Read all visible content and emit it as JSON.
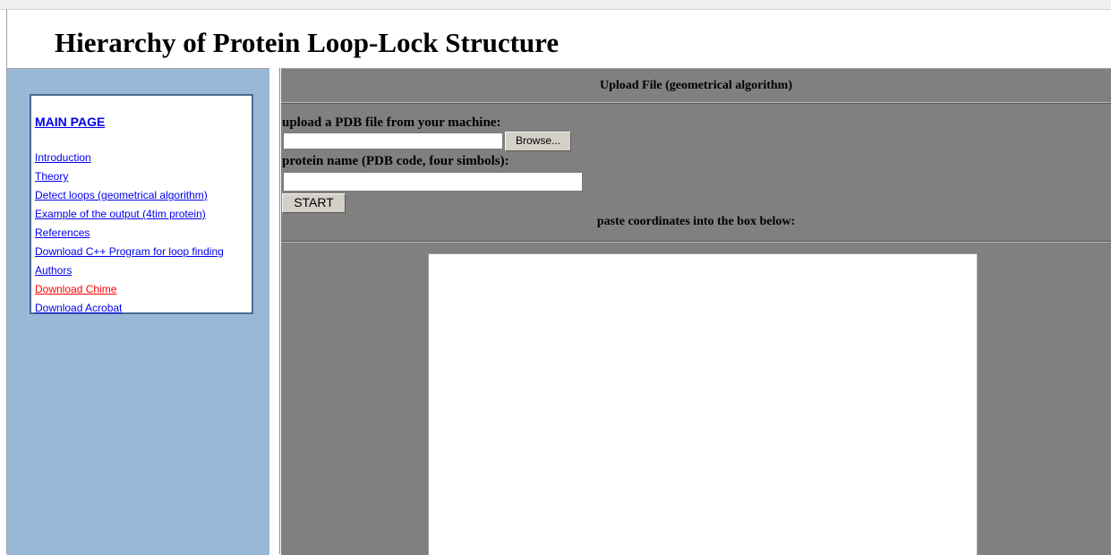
{
  "header": {
    "title": "Hierarchy of Protein Loop-Lock Structure"
  },
  "sidebar": {
    "main_link": "MAIN PAGE",
    "items": [
      {
        "label": "Introduction"
      },
      {
        "label": "Theory"
      },
      {
        "label": "Detect loops (geometrical algorithm)"
      },
      {
        "label": "Example of the output (4tim protein)"
      },
      {
        "label": "References"
      },
      {
        "label": "Download C++ Program for loop finding"
      },
      {
        "label": "Authors"
      },
      {
        "label": "Download Chime"
      },
      {
        "label": "Download Acrobat"
      }
    ]
  },
  "main": {
    "section_title": "Upload File (geometrical algorithm)",
    "upload_label": "upload a PDB file from your machine:",
    "browse_label": "Browse...",
    "protein_label": "protein name (PDB code, four simbols):",
    "protein_value": "",
    "start_label": "START",
    "paste_label": "paste coordinates into the box below:",
    "coordinates_value": ""
  },
  "colors": {
    "sidebar_bg": "#98b8d8",
    "main_bg": "#808080",
    "link": "#0000ee",
    "visited_link": "#ff0000",
    "nav_border": "#4a6a96"
  },
  "icons": []
}
